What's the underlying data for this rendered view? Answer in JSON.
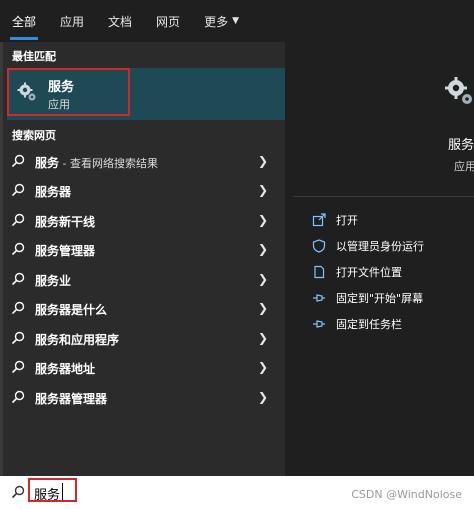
{
  "tabs": [
    {
      "label": "全部"
    },
    {
      "label": "应用"
    },
    {
      "label": "文档"
    },
    {
      "label": "网页"
    },
    {
      "label": "更多"
    }
  ],
  "best_match": {
    "title": "最佳匹配",
    "name": "服务",
    "kind": "应用",
    "icon": "gear-icon"
  },
  "web_search": {
    "title": "搜索网页",
    "items": [
      {
        "label": "服务",
        "sub": " - 查看网络搜索结果"
      },
      {
        "label": "服务器",
        "sub": ""
      },
      {
        "label": "服务新干线",
        "sub": ""
      },
      {
        "label": "服务管理器",
        "sub": ""
      },
      {
        "label": "服务业",
        "sub": ""
      },
      {
        "label": "服务器是什么",
        "sub": ""
      },
      {
        "label": "服务和应用程序",
        "sub": ""
      },
      {
        "label": "服务器地址",
        "sub": ""
      },
      {
        "label": "服务器管理器",
        "sub": ""
      }
    ]
  },
  "detail": {
    "name": "服务",
    "kind": "应用",
    "actions": [
      {
        "label": "打开",
        "icon": "open-icon"
      },
      {
        "label": "以管理员身份运行",
        "icon": "shield-icon"
      },
      {
        "label": "打开文件位置",
        "icon": "file-location-icon"
      },
      {
        "label": "固定到\"开始\"屏幕",
        "icon": "pin-icon"
      },
      {
        "label": "固定到任务栏",
        "icon": "pin-icon"
      }
    ]
  },
  "search": {
    "value": "服务"
  },
  "watermark": "CSDN @WindNolose",
  "colors": {
    "accent": "#2f8fd6",
    "highlight": "#1e4a55",
    "annotation": "#d6262b"
  }
}
